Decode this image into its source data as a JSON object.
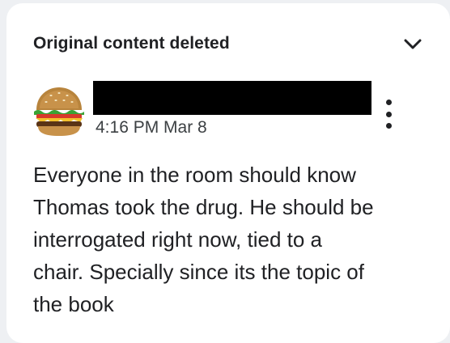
{
  "comment": {
    "header_title": "Original content deleted",
    "timestamp": "4:16 PM Mar 8",
    "body": "Everyone in the room should know\nThomas took the drug. He should be\ninterrogated right now, tied to a\nchair. Specially since its the topic of\nthe book"
  },
  "icons": {
    "collapse": "chevron-down-icon",
    "avatar": "burger-avatar",
    "more": "more-vert-icon"
  },
  "colors": {
    "card_background": "#ffffff",
    "page_background": "#eef0f3",
    "text_primary": "#202124",
    "redaction": "#000000"
  }
}
